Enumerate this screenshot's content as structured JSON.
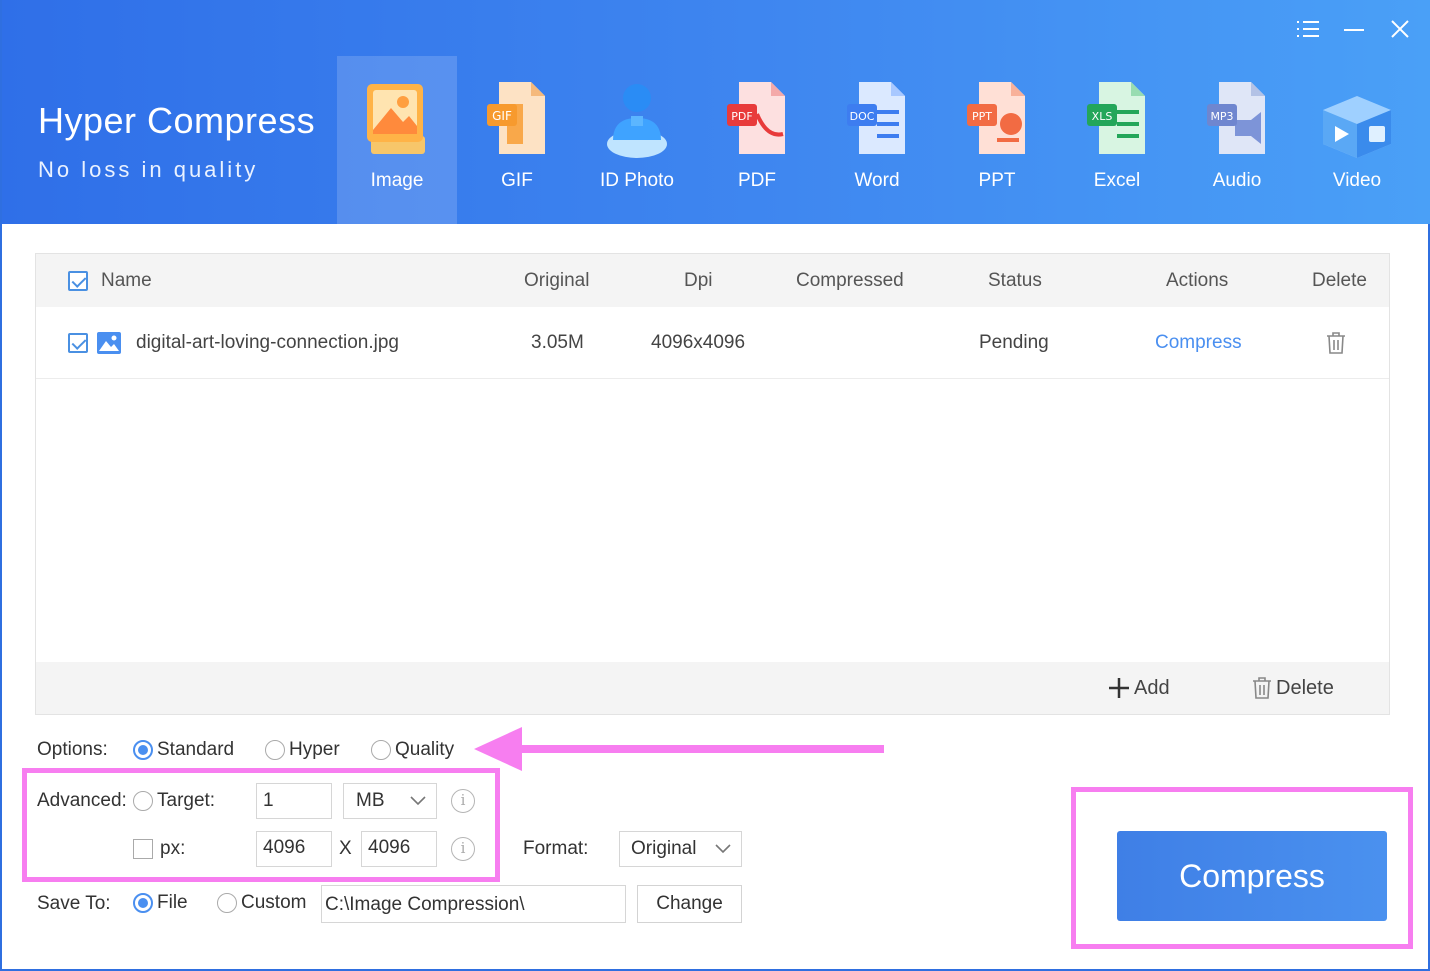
{
  "app": {
    "title": "Hyper Compress",
    "subtitle": "No loss in quality"
  },
  "window_controls": {
    "icons": [
      "menu-icon",
      "minimize-icon",
      "close-icon"
    ]
  },
  "tools": [
    {
      "label": "Image",
      "icon": "image-icon",
      "active": true
    },
    {
      "label": "GIF",
      "icon": "gif-icon"
    },
    {
      "label": "ID Photo",
      "icon": "id-photo-icon"
    },
    {
      "label": "PDF",
      "icon": "pdf-icon"
    },
    {
      "label": "Word",
      "icon": "word-icon"
    },
    {
      "label": "PPT",
      "icon": "ppt-icon"
    },
    {
      "label": "Excel",
      "icon": "excel-icon"
    },
    {
      "label": "Audio",
      "icon": "audio-icon"
    },
    {
      "label": "Video",
      "icon": "video-icon"
    }
  ],
  "table": {
    "columns": [
      "Name",
      "Original",
      "Dpi",
      "Compressed",
      "Status",
      "Actions",
      "Delete"
    ],
    "rows": [
      {
        "name": "digital-art-loving-connection.jpg",
        "original": "3.05M",
        "dpi": "4096x4096",
        "compressed": "",
        "status": "Pending",
        "action": "Compress",
        "checked": true
      }
    ],
    "footer": {
      "add": "Add",
      "delete": "Delete"
    }
  },
  "options": {
    "label": "Options:",
    "choices": [
      "Standard",
      "Hyper",
      "Quality"
    ],
    "selected": "Standard"
  },
  "advanced": {
    "label": "Advanced:",
    "target_label": "Target:",
    "target_value": "1",
    "target_unit": "MB",
    "px_label": "px:",
    "width": "4096",
    "x_sep": "X",
    "height": "4096",
    "info_glyph": "i"
  },
  "format": {
    "label": "Format:",
    "value": "Original"
  },
  "save_to": {
    "label": "Save To:",
    "choices": [
      "File",
      "Custom"
    ],
    "selected": "File",
    "path": "C:\\Image Compression\\",
    "change": "Change"
  },
  "compress_button": "Compress",
  "colors": {
    "accent": "#4a8ff0",
    "header": "#3a7fec",
    "annotation": "#f77ef0"
  }
}
